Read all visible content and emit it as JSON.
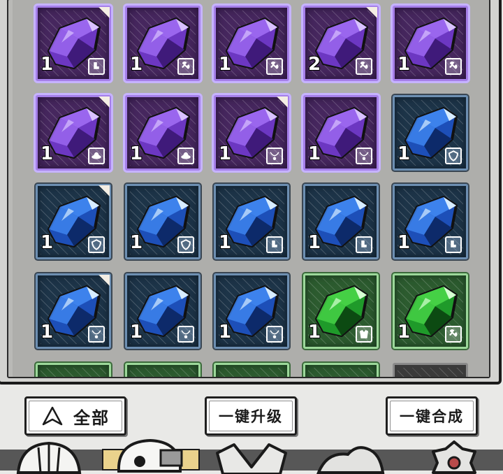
{
  "inventory": {
    "rows": [
      [
        {
          "rarity": "purple",
          "count": "1",
          "type": "boot-icon",
          "new": true
        },
        {
          "rarity": "purple",
          "count": "1",
          "type": "wrench-icon",
          "new": false
        },
        {
          "rarity": "purple",
          "count": "1",
          "type": "wrench-icon",
          "new": false
        },
        {
          "rarity": "purple",
          "count": "2",
          "type": "wrench-icon",
          "new": true
        },
        {
          "rarity": "purple",
          "count": "1",
          "type": "wrench-icon",
          "new": false
        }
      ],
      [
        {
          "rarity": "purple",
          "count": "1",
          "type": "hat-icon",
          "new": true
        },
        {
          "rarity": "purple",
          "count": "1",
          "type": "hat-icon",
          "new": false
        },
        {
          "rarity": "purple",
          "count": "1",
          "type": "necklace-icon",
          "new": true
        },
        {
          "rarity": "purple",
          "count": "1",
          "type": "necklace-icon",
          "new": false
        },
        {
          "rarity": "blue",
          "count": "1",
          "type": "shield-icon",
          "new": false
        }
      ],
      [
        {
          "rarity": "blue",
          "count": "1",
          "type": "shield-icon",
          "new": true
        },
        {
          "rarity": "blue",
          "count": "1",
          "type": "shield-icon",
          "new": false
        },
        {
          "rarity": "blue",
          "count": "1",
          "type": "boot-icon",
          "new": false
        },
        {
          "rarity": "blue",
          "count": "1",
          "type": "boot-icon",
          "new": false
        },
        {
          "rarity": "blue",
          "count": "1",
          "type": "boot-icon",
          "new": false
        }
      ],
      [
        {
          "rarity": "blue",
          "count": "1",
          "type": "necklace-icon",
          "new": true
        },
        {
          "rarity": "blue",
          "count": "1",
          "type": "necklace-icon",
          "new": false
        },
        {
          "rarity": "blue",
          "count": "1",
          "type": "necklace-icon",
          "new": false
        },
        {
          "rarity": "green",
          "count": "1",
          "type": "armor-icon",
          "new": false
        },
        {
          "rarity": "green",
          "count": "1",
          "type": "wrench-icon",
          "new": false
        }
      ],
      [
        {
          "rarity": "green",
          "count": "",
          "type": "",
          "new": false
        },
        {
          "rarity": "green",
          "count": "",
          "type": "",
          "new": false
        },
        {
          "rarity": "green",
          "count": "",
          "type": "",
          "new": false
        },
        {
          "rarity": "green",
          "count": "",
          "type": "",
          "new": false
        },
        {
          "rarity": "dark",
          "count": "",
          "type": "",
          "new": false
        }
      ]
    ]
  },
  "actions": {
    "filter_label": "全部",
    "upgrade_label": "一键升级",
    "merge_label": "一键合成"
  },
  "colors": {
    "purple_gem": "#8b57e6",
    "blue_gem": "#2d6fe0",
    "green_gem": "#2fbf2f"
  }
}
